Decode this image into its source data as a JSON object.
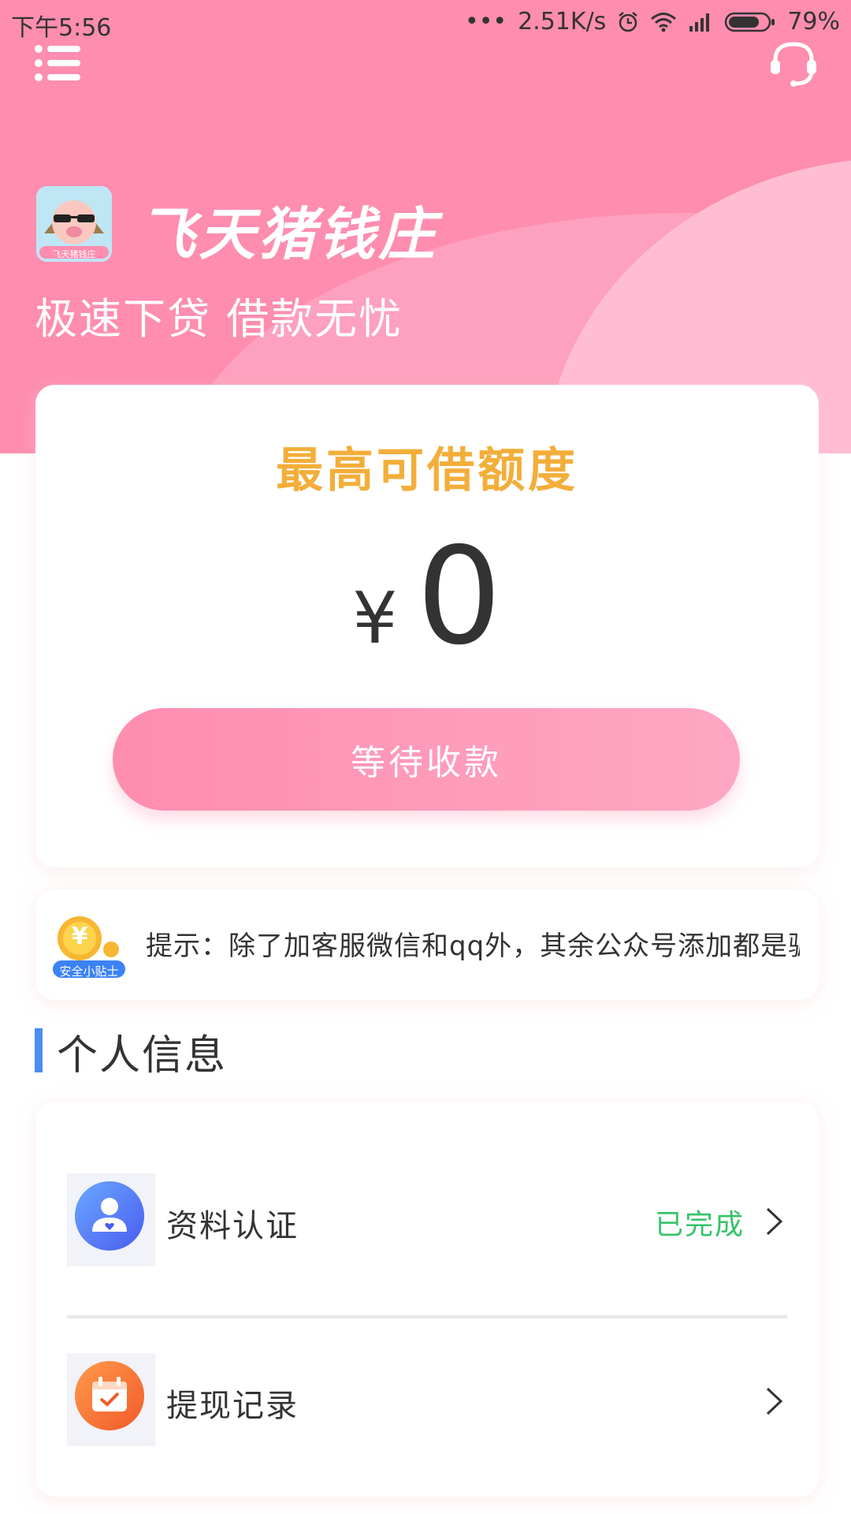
{
  "status_bar": {
    "time": "下午5:56",
    "dots": "•••",
    "network_speed": "2.51K/s",
    "battery_percent": "79%",
    "battery_level": 0.79,
    "icons": [
      "alarm-icon",
      "wifi-icon",
      "signal-icon",
      "battery-icon"
    ]
  },
  "header": {
    "menu_icon": "menu-icon",
    "support_icon": "customer-service-headset-icon",
    "app_name": "飞天猪钱庄",
    "logo_text": "飞天猪钱庄",
    "slogan": "极速下贷 借款无忧"
  },
  "limit_card": {
    "title": "最高可借额度",
    "currency_symbol": "¥",
    "amount": "0",
    "button_label": "等待收款"
  },
  "tip": {
    "badge_text": "安全小贴士",
    "badge_coin": "¥",
    "text": "提示：除了加客服微信和qq外，其余公众号添加都是骗"
  },
  "personal_info": {
    "section_title": "个人信息",
    "items": [
      {
        "label": "资料认证",
        "status": "已完成",
        "icon": "user-profile-icon"
      },
      {
        "label": "提现记录",
        "status": "",
        "icon": "calendar-check-icon"
      }
    ]
  },
  "colors": {
    "brand_pink": "#fe8db0",
    "title_orange": "#f3ae3a",
    "success_green": "#35c36a",
    "section_blue": "#4b8ef0"
  }
}
